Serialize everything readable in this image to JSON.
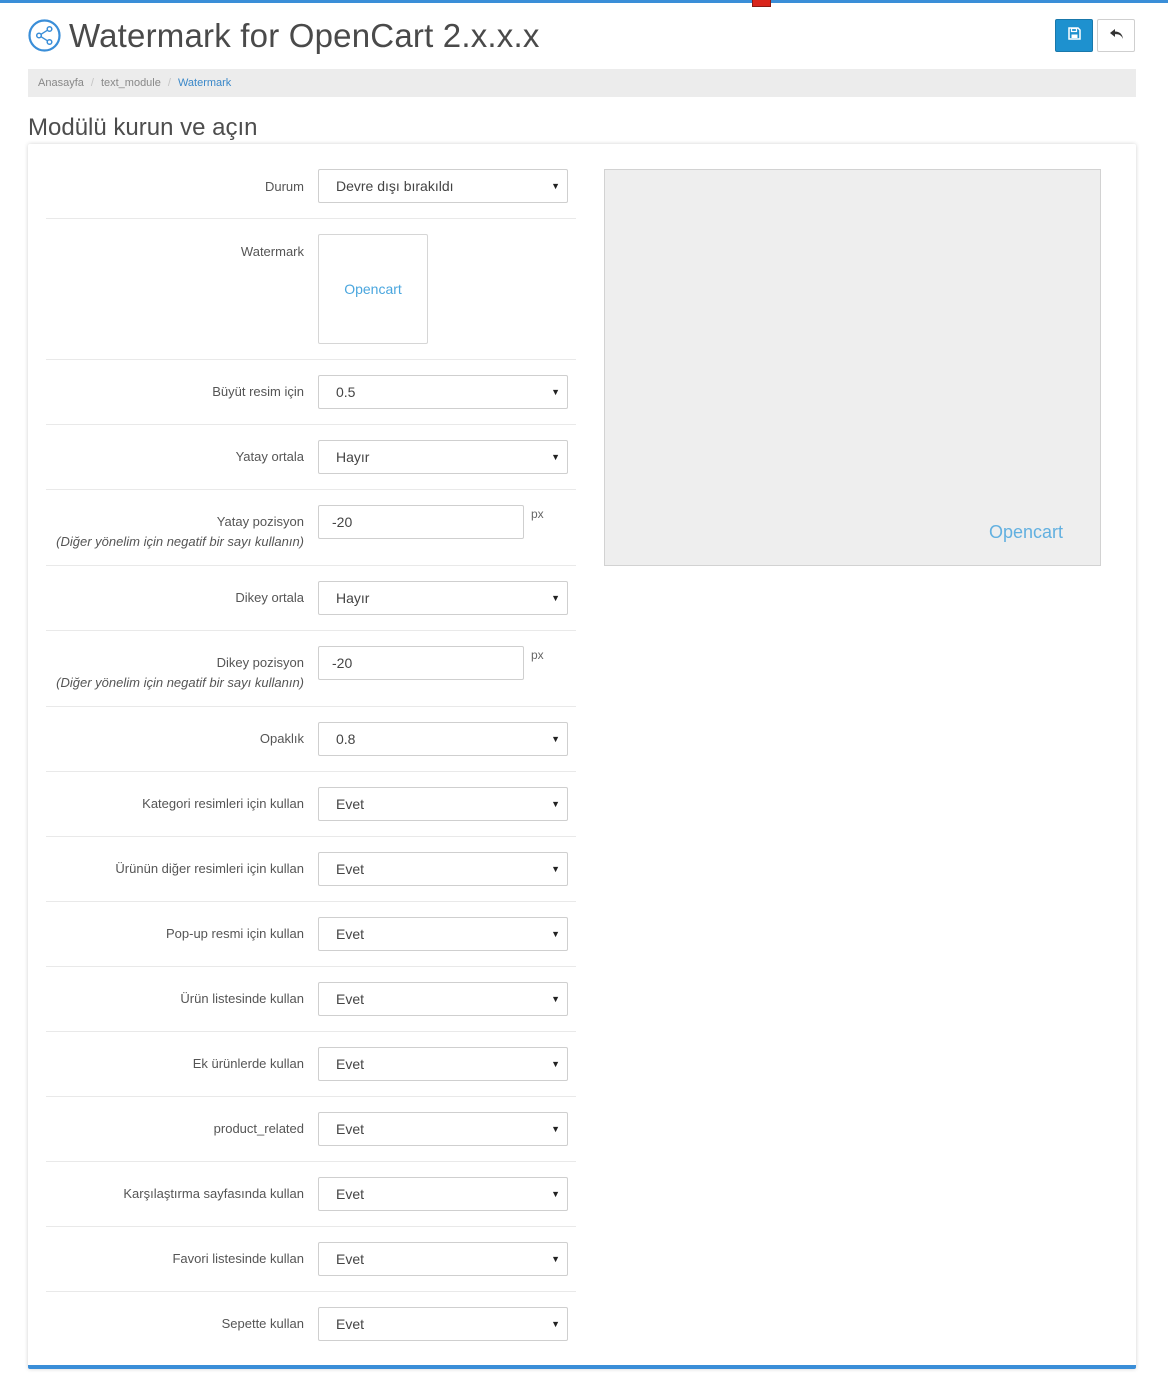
{
  "header": {
    "title": "Watermark for OpenCart 2.x.x.x",
    "title_icon": "share-icon",
    "save_icon": "floppy-disk-icon",
    "back_icon": "reply-arrow-icon"
  },
  "breadcrumb": [
    {
      "label": "Anasayfa"
    },
    {
      "label": "text_module"
    },
    {
      "label": "Watermark"
    }
  ],
  "section_title": "Modülü kurun ve açın",
  "colors": {
    "accent": "#1e91cf",
    "top_border": "#3a8ed8",
    "link": "#3a88c9",
    "watermark_text": "#4aa6de"
  },
  "form": {
    "status": {
      "label": "Durum",
      "value": "Devre dışı bırakıldı"
    },
    "watermark": {
      "label": "Watermark",
      "image_text": "Opencart"
    },
    "scale": {
      "label": "Büyüt resim için",
      "value": "0.5"
    },
    "h_center": {
      "label": "Yatay ortala",
      "value": "Hayır"
    },
    "h_position": {
      "label": "Yatay pozisyon",
      "help": "(Diğer yönelim için negatif bir sayı kullanın)",
      "value": "-20",
      "unit": "px"
    },
    "v_center": {
      "label": "Dikey ortala",
      "value": "Hayır"
    },
    "v_position": {
      "label": "Dikey pozisyon",
      "help": "(Diğer yönelim için negatif bir sayı kullanın)",
      "value": "-20",
      "unit": "px"
    },
    "opacity": {
      "label": "Opaklık",
      "value": "0.8"
    },
    "category_images": {
      "label": "Kategori resimleri için kullan",
      "value": "Evet"
    },
    "product_other_images": {
      "label": "Ürünün diğer resimleri için kullan",
      "value": "Evet"
    },
    "popup_image": {
      "label": "Pop-up resmi için kullan",
      "value": "Evet"
    },
    "product_list": {
      "label": "Ürün listesinde kullan",
      "value": "Evet"
    },
    "additional_products": {
      "label": "Ek ürünlerde kullan",
      "value": "Evet"
    },
    "product_related": {
      "label": "product_related",
      "value": "Evet"
    },
    "compare_page": {
      "label": "Karşılaştırma sayfasında kullan",
      "value": "Evet"
    },
    "wishlist": {
      "label": "Favori listesinde kullan",
      "value": "Evet"
    },
    "cart": {
      "label": "Sepette kullan",
      "value": "Evet"
    }
  },
  "preview": {
    "watermark_text": "Opencart"
  }
}
